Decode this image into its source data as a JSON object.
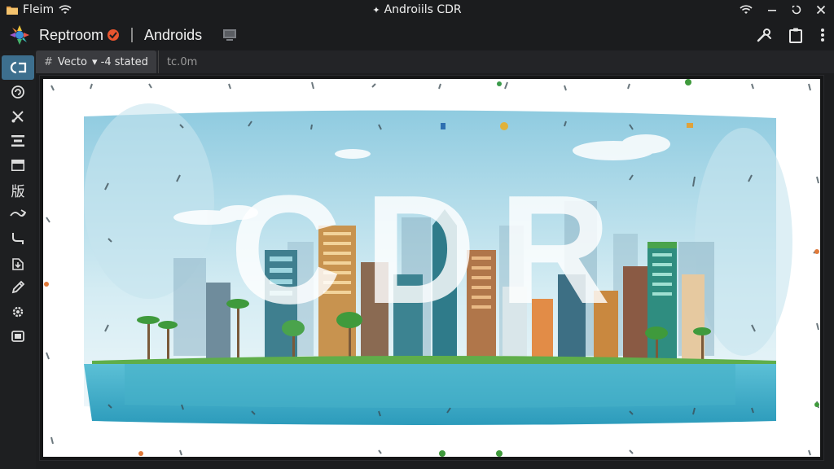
{
  "status_bar": {
    "left_label": "Fleim",
    "center_title": "Androiils CDR"
  },
  "app_bar": {
    "app_name": "Reptroom",
    "project_name": "Androids"
  },
  "tabs": [
    {
      "label": "Vecto",
      "extra": "▾ -4 stated",
      "active": true
    },
    {
      "label": "tc.0m",
      "active": false
    }
  ],
  "artwork": {
    "headline": "CDR"
  },
  "rail": {
    "text_tool_glyph": "版"
  },
  "colors": {
    "active_tool": "#3d6f8e",
    "sea": "#3aa7c2",
    "sky": "#bfe3ee"
  },
  "icons": {
    "status_left": [
      "folder-icon",
      "wifi-icon"
    ],
    "status_right": [
      "wifi-icon",
      "minimize-icon",
      "restore-icon",
      "close-icon"
    ],
    "app_bar": [
      "app-logo-icon",
      "badge-icon",
      "project-icon",
      "tools-icon",
      "clipboard-icon",
      "more-vert-icon"
    ],
    "rail": [
      "shape-tool-icon",
      "refresh-tool-icon",
      "scissors-tool-icon",
      "align-tool-icon",
      "panel-tool-icon",
      "text-tool-icon",
      "arrow-tool-icon",
      "curve-tool-icon",
      "export-tool-icon",
      "pen-tool-icon",
      "settings-tool-icon",
      "layers-tool-icon"
    ]
  }
}
